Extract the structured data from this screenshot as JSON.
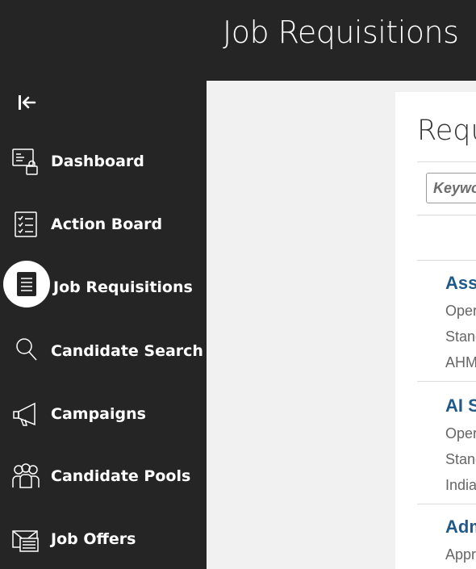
{
  "header": {
    "title": "Job Requisitions"
  },
  "sidebar": {
    "collapse_icon": "collapse-left-icon",
    "items": [
      {
        "label": "Dashboard",
        "icon": "dashboard-icon",
        "active": false
      },
      {
        "label": "Action Board",
        "icon": "checklist-icon",
        "active": false
      },
      {
        "label": "Job Requisitions",
        "icon": "document-icon",
        "active": true
      },
      {
        "label": "Candidate Search",
        "icon": "search-icon",
        "active": false
      },
      {
        "label": "Campaigns",
        "icon": "megaphone-icon",
        "active": false
      },
      {
        "label": "Candidate Pools",
        "icon": "people-icon",
        "active": false
      },
      {
        "label": "Job Offers",
        "icon": "envelope-icon",
        "active": false
      }
    ]
  },
  "main": {
    "panel_title": "Requ",
    "search": {
      "placeholder": "Keywo"
    },
    "requisitions": [
      {
        "title": "Assi",
        "status": "Oper",
        "type": "Stand",
        "location": "AHM"
      },
      {
        "title": "AI S",
        "status": "Oper",
        "type": "Stand",
        "location": "India"
      },
      {
        "title": "Adm",
        "status": "Appr"
      }
    ]
  },
  "colors": {
    "sidebar_bg": "#252525",
    "content_bg": "#f1f1f1",
    "link": "#1f5a8a",
    "active_circle": "#ffffff"
  }
}
